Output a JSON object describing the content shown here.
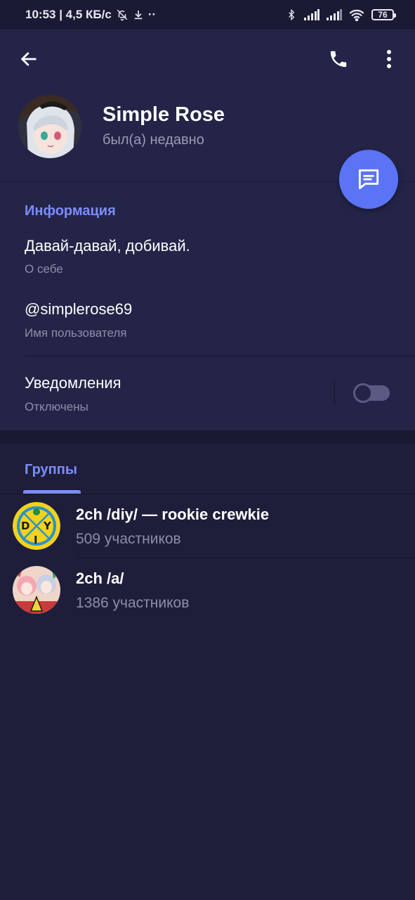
{
  "status_bar": {
    "time_and_speed": "10:53 | 4,5 КБ/с",
    "dots": "··",
    "battery": "76"
  },
  "profile": {
    "name": "Simple Rose",
    "status": "был(а) недавно"
  },
  "info": {
    "section_title": "Информация",
    "bio": "Давай-давай, добивай.",
    "bio_caption": "О себе",
    "username": "@simplerose69",
    "username_caption": "Имя пользователя",
    "notifications": "Уведомления",
    "notifications_caption": "Отключены",
    "notifications_enabled": false
  },
  "groups": {
    "tab_label": "Группы",
    "items": [
      {
        "name": "2ch /diy/ — rookie crewkie",
        "members": "509 участников"
      },
      {
        "name": "2ch /a/",
        "members": "1386 участников"
      }
    ]
  },
  "colors": {
    "accent": "#7d8cfb",
    "fab": "#5b73f5",
    "background": "#1e1e3b",
    "panel": "#242448"
  }
}
